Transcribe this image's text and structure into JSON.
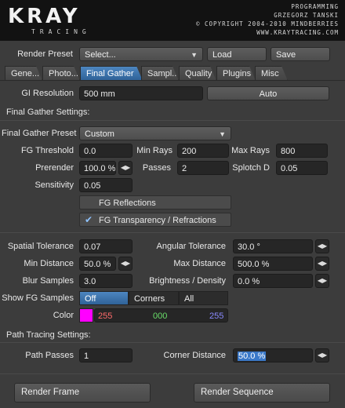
{
  "header": {
    "logo": "KRAY",
    "logo_sub": "TRACING",
    "line1": "PROGRAMMING",
    "line2": "GRZEGORZ TANSKI",
    "line3": "© COPYRIGHT 2004-2010 MINDBERRIES",
    "line4": "WWW.KRAYTRACING.COM"
  },
  "preset": {
    "label": "Render Preset",
    "value": "Select...",
    "load": "Load",
    "save": "Save"
  },
  "tabs": [
    {
      "label": "Gene..."
    },
    {
      "label": "Photo..."
    },
    {
      "label": "Final Gather"
    },
    {
      "label": "Sampl..."
    },
    {
      "label": "Quality"
    },
    {
      "label": "Plugins"
    },
    {
      "label": "Misc"
    }
  ],
  "gi": {
    "label": "GI Resolution",
    "value": "500 mm",
    "mode": "Auto"
  },
  "fg_settings": {
    "title": "Final Gather Settings:",
    "preset_label": "Final Gather Preset",
    "preset_value": "Custom",
    "threshold_label": "FG Threshold",
    "threshold": "0.0",
    "min_rays_label": "Min Rays",
    "min_rays": "200",
    "max_rays_label": "Max Rays",
    "max_rays": "800",
    "prerender_label": "Prerender",
    "prerender": "100.0 %",
    "passes_label": "Passes",
    "passes": "2",
    "splotch_label": "Splotch D",
    "splotch": "0.05",
    "sensitivity_label": "Sensitivity",
    "sensitivity": "0.05",
    "reflections": "FG Reflections",
    "refractions": "FG Transparency / Refractions"
  },
  "tolerances": {
    "spatial_label": "Spatial Tolerance",
    "spatial": "0.07",
    "angular_label": "Angular Tolerance",
    "angular": "30.0 °",
    "min_dist_label": "Min Distance",
    "min_dist": "50.0 %",
    "max_dist_label": "Max Distance",
    "max_dist": "500.0 %",
    "blur_label": "Blur Samples",
    "blur": "3.0",
    "brightness_label": "Brightness / Density",
    "brightness": "0.0 %",
    "show_label": "Show FG Samples",
    "show_options": [
      "Off",
      "Corners",
      "All"
    ],
    "color_label": "Color",
    "color_r": "255",
    "color_g": "000",
    "color_b": "255",
    "swatch": "#ff00ff"
  },
  "path_tracing": {
    "title": "Path Tracing Settings:",
    "passes_label": "Path Passes",
    "passes": "1",
    "corner_label": "Corner Distance",
    "corner": "50.0 %"
  },
  "actions": {
    "render_frame": "Render Frame",
    "render_sequence": "Render Sequence"
  }
}
